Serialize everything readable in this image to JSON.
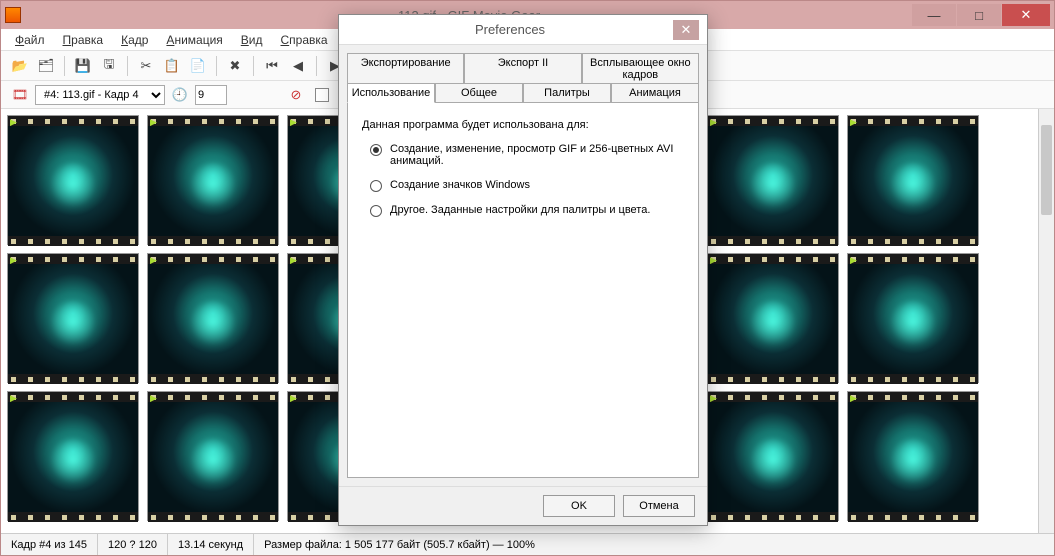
{
  "window": {
    "title": "113.gif - GIF Movie Gear"
  },
  "menu": {
    "file": "Файл",
    "edit": "Правка",
    "frame": "Кадр",
    "animation": "Анимация",
    "view": "Вид",
    "help": "Справка"
  },
  "toolbar2": {
    "frame_selector": "#4: 113.gif - Кадр 4",
    "delay_value": "9"
  },
  "status": {
    "frame_of": "Кадр #4 из 145",
    "dims": "120 ? 120",
    "duration": "13.14 секунд",
    "filesize": "Размер файла: 1 505 177 байт (505.7 кбайт) — 100%"
  },
  "dialog": {
    "title": "Preferences",
    "tabs": {
      "export": "Экспортирование",
      "export2": "Экспорт II",
      "popup": "Всплывающее окно кадров",
      "usage": "Использование",
      "general": "Общее",
      "palettes": "Палитры",
      "animation": "Анимация"
    },
    "intro": "Данная программа будет использована для:",
    "opt1": "Создание, изменение, просмотр GIF и 256-цветных AVI анимаций.",
    "opt2": "Создание значков Windows",
    "opt3": "Другое. Заданные настройки для палитры и цвета.",
    "ok": "OK",
    "cancel": "Отмена"
  }
}
